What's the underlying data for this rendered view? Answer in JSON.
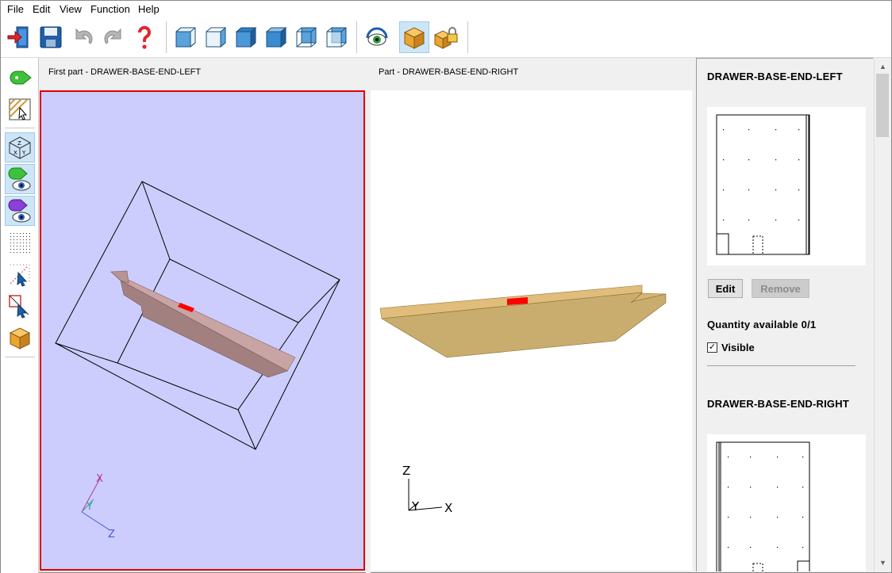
{
  "menu": {
    "file": "File",
    "edit": "Edit",
    "view": "View",
    "function": "Function",
    "help": "Help"
  },
  "toolbar": {
    "icons": [
      "exit-icon",
      "save-icon",
      "undo-icon",
      "redo-icon",
      "help-icon",
      "view-cube-front-icon",
      "view-cube-left-icon",
      "view-cube-top-icon",
      "view-cube-right-icon",
      "view-cube-back-icon",
      "view-cube-iso-icon",
      "eye-view-icon",
      "part-box-icon",
      "lock-box-icon"
    ]
  },
  "left_panel": {
    "header": "First part - DRAWER-BASE-END-LEFT",
    "axis_labels": {
      "x": "X",
      "y": "Y",
      "z": "Z"
    }
  },
  "right_panel": {
    "header": "Part - DRAWER-BASE-END-RIGHT",
    "axis_labels": {
      "x": "X",
      "y": "Y",
      "z": "Z"
    }
  },
  "side_panel": {
    "parts": [
      {
        "title": "DRAWER-BASE-END-LEFT",
        "edit_label": "Edit",
        "remove_label": "Remove",
        "quantity_label": "Quantity available 0/1",
        "visible_label": "Visible",
        "visible_checked": true
      },
      {
        "title": "DRAWER-BASE-END-RIGHT"
      }
    ]
  },
  "colors": {
    "left_view_bg": "#cccdfd",
    "selection_border": "#e00000",
    "panel_left_color": "#a88080",
    "panel_right_color": "#c9ad6e",
    "highlight": "#ff0000"
  }
}
